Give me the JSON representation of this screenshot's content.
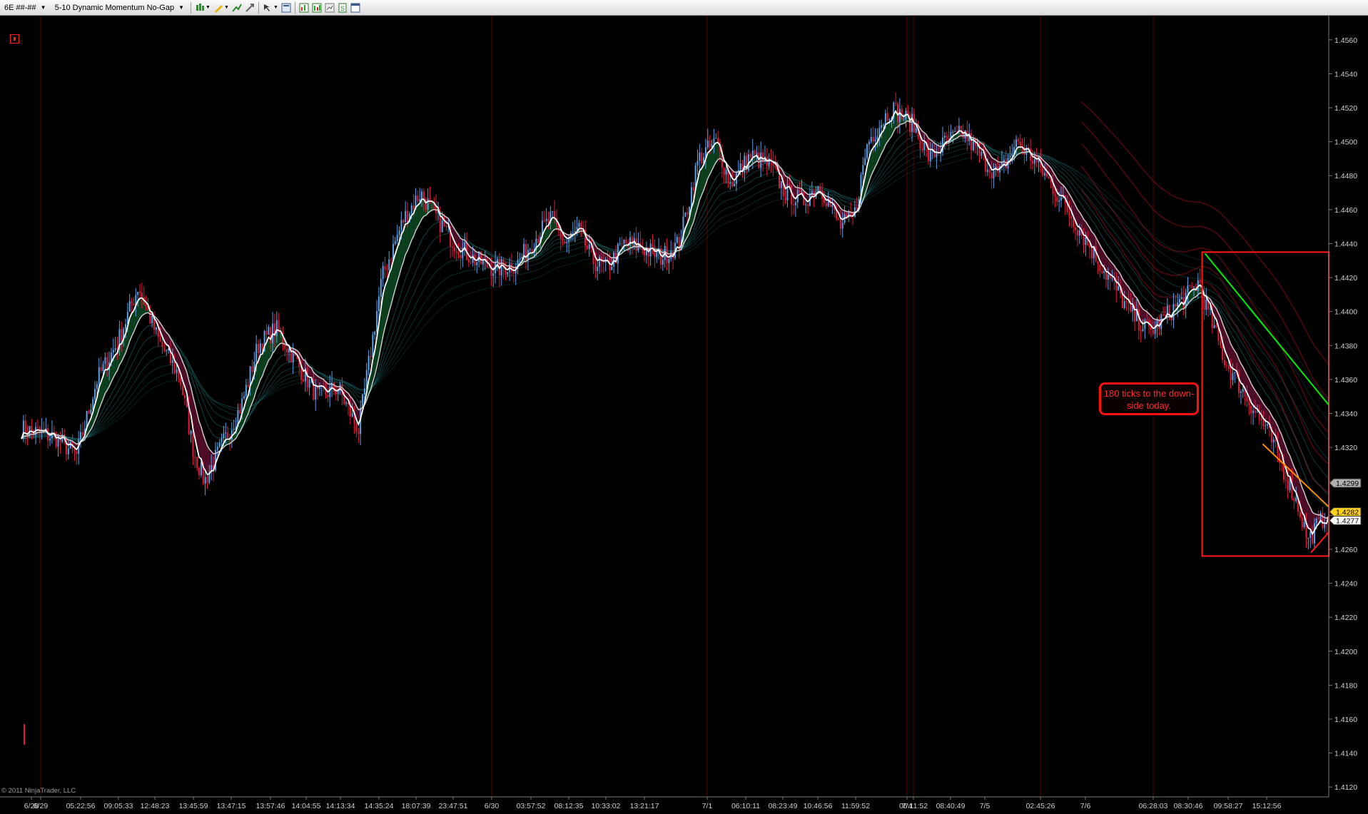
{
  "toolbar": {
    "instrument": "6E ##-##",
    "template": "5-10 Dynamic Momentum No-Gap",
    "icons": [
      "bar-style-icon",
      "pencil-draw-icon",
      "indicator-add-icon",
      "strategy-icon",
      "zoom-icon",
      "properties-icon",
      "chart-data-icon",
      "indicators-icon",
      "compare-icon",
      "excel-icon",
      "window-icon"
    ]
  },
  "colors": {
    "background": "#000000",
    "up_candle": "#5aa2e8",
    "down_candle": "#e8183a",
    "fast_ma": "#ffffff",
    "slow_ma": "#c8c8c8",
    "bull_fill": "#0d4a22",
    "bear_fill": "#5a0f2e",
    "ribbon": "#1e7a7a",
    "session_line": "#5a0000",
    "trend_line_green": "#00ee00",
    "trend_line_orange": "#ff8c00",
    "box": "#ff1a1a"
  },
  "chart_data": {
    "type": "candlestick",
    "instrument": "6E ##-##",
    "ylim": [
      1.411,
      1.457
    ],
    "y_ticks": [
      "1.4560",
      "1.4540",
      "1.4520",
      "1.4500",
      "1.4480",
      "1.4460",
      "1.4440",
      "1.4420",
      "1.4400",
      "1.4380",
      "1.4360",
      "1.4340",
      "1.4320",
      "1.4300",
      "1.4280",
      "1.4260",
      "1.4240",
      "1.4220",
      "1.4200",
      "1.4180",
      "1.4160",
      "1.4140",
      "1.4120"
    ],
    "y_tick_values": [
      1.456,
      1.454,
      1.452,
      1.45,
      1.448,
      1.446,
      1.444,
      1.442,
      1.44,
      1.438,
      1.436,
      1.434,
      1.432,
      1.43,
      1.428,
      1.426,
      1.424,
      1.422,
      1.42,
      1.418,
      1.416,
      1.414,
      1.412
    ],
    "x_ticks": [
      "6/28",
      "6/29",
      "05:22:56",
      "09:05:33",
      "12:48:23",
      "13:45:59",
      "13:47:15",
      "13:57:46",
      "14:04:55",
      "14:13:34",
      "14:35:24",
      "18:07:39",
      "23:47:51",
      "6/30",
      "03:57:52",
      "08:12:35",
      "10:33:02",
      "13:21:17",
      "7/1",
      "06:10:11",
      "08:23:49",
      "10:46:56",
      "11:59:52",
      "7/4",
      "06:11:52",
      "08:40:49",
      "7/5",
      "02:45:26",
      "7/6",
      "06:28:03",
      "08:30:46",
      "09:58:27",
      "15:12:56"
    ],
    "price_path": [
      [
        0,
        1.4331
      ],
      [
        25,
        1.4326
      ],
      [
        40,
        1.4315
      ],
      [
        55,
        1.436
      ],
      [
        70,
        1.4382
      ],
      [
        85,
        1.4415
      ],
      [
        100,
        1.4382
      ],
      [
        115,
        1.4362
      ],
      [
        125,
        1.4318
      ],
      [
        133,
        1.43
      ],
      [
        145,
        1.432
      ],
      [
        160,
        1.4345
      ],
      [
        172,
        1.438
      ],
      [
        185,
        1.439
      ],
      [
        200,
        1.437
      ],
      [
        215,
        1.435
      ],
      [
        230,
        1.4355
      ],
      [
        245,
        1.433
      ],
      [
        262,
        1.442
      ],
      [
        278,
        1.4455
      ],
      [
        290,
        1.447
      ],
      [
        302,
        1.4455
      ],
      [
        315,
        1.444
      ],
      [
        330,
        1.443
      ],
      [
        345,
        1.4425
      ],
      [
        360,
        1.4428
      ],
      [
        375,
        1.4445
      ],
      [
        385,
        1.4455
      ],
      [
        395,
        1.444
      ],
      [
        405,
        1.4448
      ],
      [
        415,
        1.443
      ],
      [
        425,
        1.4425
      ],
      [
        438,
        1.444
      ],
      [
        450,
        1.4438
      ],
      [
        465,
        1.4432
      ],
      [
        478,
        1.444
      ],
      [
        492,
        1.449
      ],
      [
        505,
        1.45
      ],
      [
        515,
        1.4475
      ],
      [
        530,
        1.4492
      ],
      [
        545,
        1.4485
      ],
      [
        555,
        1.447
      ],
      [
        568,
        1.4465
      ],
      [
        580,
        1.4475
      ],
      [
        595,
        1.445
      ],
      [
        605,
        1.4455
      ],
      [
        615,
        1.45
      ],
      [
        632,
        1.452
      ],
      [
        648,
        1.451
      ],
      [
        660,
        1.449
      ],
      [
        672,
        1.45
      ],
      [
        685,
        1.4505
      ],
      [
        698,
        1.449
      ],
      [
        710,
        1.448
      ],
      [
        724,
        1.45
      ],
      [
        740,
        1.4485
      ],
      [
        760,
        1.446
      ],
      [
        775,
        1.444
      ],
      [
        790,
        1.442
      ],
      [
        805,
        1.44
      ],
      [
        820,
        1.4388
      ],
      [
        835,
        1.44
      ],
      [
        848,
        1.441
      ],
      [
        856,
        1.4418
      ],
      [
        860,
        1.4405
      ],
      [
        875,
        1.437
      ],
      [
        890,
        1.435
      ],
      [
        905,
        1.433
      ],
      [
        918,
        1.4305
      ],
      [
        928,
        1.4285
      ],
      [
        935,
        1.4265
      ],
      [
        940,
        1.4272
      ],
      [
        950,
        1.4282
      ]
    ],
    "price_path_x_max": 950,
    "last_prices": [
      {
        "label": "1.4299",
        "value": 1.4299,
        "color": "#b0b0b0",
        "text_color": "#000000"
      },
      {
        "label": "1.4282",
        "value": 1.4282,
        "color": "#ffd21f",
        "text_color": "#000000"
      },
      {
        "label": "1.4277",
        "value": 1.4277,
        "color": "#ffffff",
        "text_color": "#000000"
      }
    ],
    "annotation": "180 ticks to the down-side today."
  },
  "copyright": "© 2011 NinjaTrader, LLC"
}
